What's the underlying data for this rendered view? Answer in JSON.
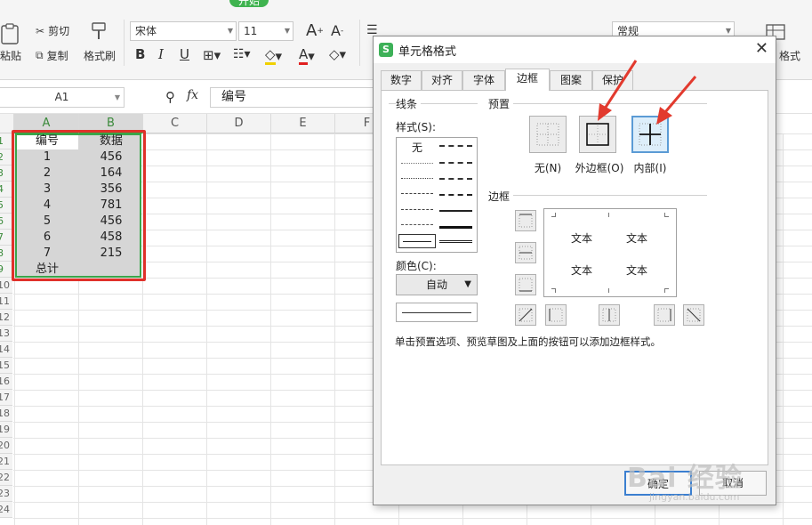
{
  "ribbon": {
    "menu_tab_active": "开始",
    "cut_label": "剪切",
    "paste_label": "粘贴",
    "copy_label": "复制",
    "format_painter_label": "格式刷",
    "font_name": "宋体",
    "font_size": "11",
    "number_format": "常规",
    "right_partial_label": "格式"
  },
  "formula_bar": {
    "name_box": "A1",
    "fx_label": "fx",
    "formula_value": "编号"
  },
  "sheet": {
    "columns": [
      "A",
      "B",
      "C",
      "D",
      "E",
      "F"
    ],
    "rows": [
      "1",
      "2",
      "3",
      "4",
      "5",
      "6",
      "7",
      "8",
      "9",
      "10",
      "11",
      "12",
      "13",
      "14",
      "15",
      "16",
      "17",
      "18",
      "19",
      "20",
      "21",
      "22",
      "23",
      "24"
    ],
    "header_a": "编号",
    "header_b": "数据",
    "data": [
      {
        "a": "1",
        "b": "456"
      },
      {
        "a": "2",
        "b": "164"
      },
      {
        "a": "3",
        "b": "356"
      },
      {
        "a": "4",
        "b": "781"
      },
      {
        "a": "5",
        "b": "456"
      },
      {
        "a": "6",
        "b": "458"
      },
      {
        "a": "7",
        "b": "215"
      }
    ],
    "total_label": "总计"
  },
  "dialog": {
    "title": "单元格格式",
    "close": "✕",
    "tabs": [
      "数字",
      "对齐",
      "字体",
      "边框",
      "图案",
      "保护"
    ],
    "active_tab": "边框",
    "line_group": "线条",
    "style_label": "样式(S):",
    "style_none": "无",
    "color_label": "颜色(C):",
    "color_value": "自动",
    "preset_group": "预置",
    "preset_none": "无(N)",
    "preset_outline": "外边框(O)",
    "preset_inside": "内部(I)",
    "border_group": "边框",
    "preview_text": [
      "文本",
      "文本",
      "文本",
      "文本"
    ],
    "hint": "单击预置选项、预览草图及上面的按钮可以添加边框样式。",
    "ok": "确定",
    "cancel": "取消"
  },
  "watermark": {
    "text": "Bai 经验",
    "sub": "jingyan.baidu.com"
  },
  "colors": {
    "accent_green": "#3aa64a",
    "annotation_red": "#e0312a",
    "preset_highlight": "#5b9bd5"
  }
}
